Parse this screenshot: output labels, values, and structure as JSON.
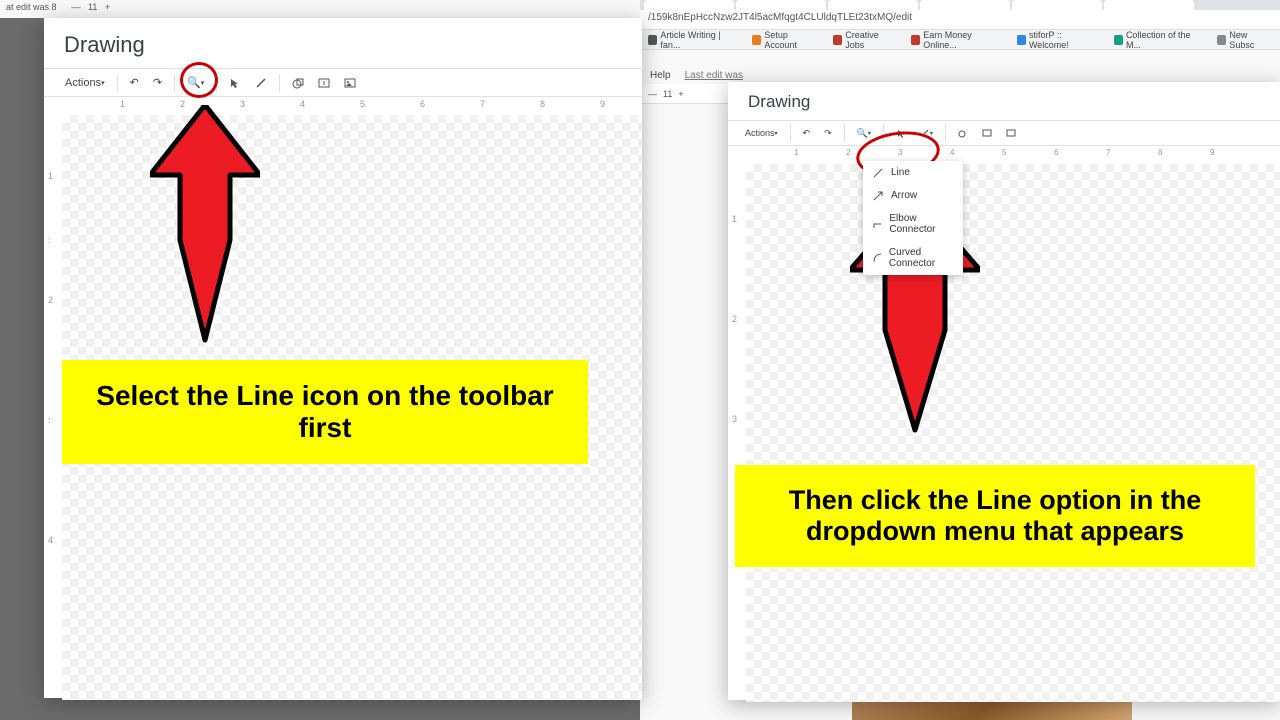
{
  "bg_left": {
    "last_edit": "at edit was 8"
  },
  "bg_right": {
    "url": "/159k8nEpHccNzw2JT4l5acMfqgt4CLUldqTLEt23txMQ/edit",
    "bookmarks": [
      "Article Writing | fan...",
      "Setup Account",
      "Creative Jobs",
      "Earn Money Online...",
      "stiforP :: Welcome!",
      "Collection of the M...",
      "New Subsc"
    ],
    "menu": {
      "help": "Help",
      "last_edit": "Last edit was"
    },
    "font_size": "11"
  },
  "left": {
    "title": "Drawing",
    "toolbar": {
      "actions": "Actions",
      "ruler_ticks": [
        "1",
        "2",
        "3",
        "4",
        "5",
        "6",
        "7",
        "8",
        "9"
      ]
    },
    "callout": "Select the Line icon on the toolbar first"
  },
  "right": {
    "title": "Drawing",
    "toolbar": {
      "actions": "Actions"
    },
    "ruler_ticks": [
      "1",
      "2",
      "3",
      "4",
      "5",
      "6",
      "7",
      "8",
      "9"
    ],
    "dropdown": {
      "line": "Line",
      "arrow": "Arrow",
      "elbow": "Elbow Connector",
      "curved": "Curved Connector"
    },
    "callout": "Then click the Line option in the dropdown menu that appears"
  }
}
